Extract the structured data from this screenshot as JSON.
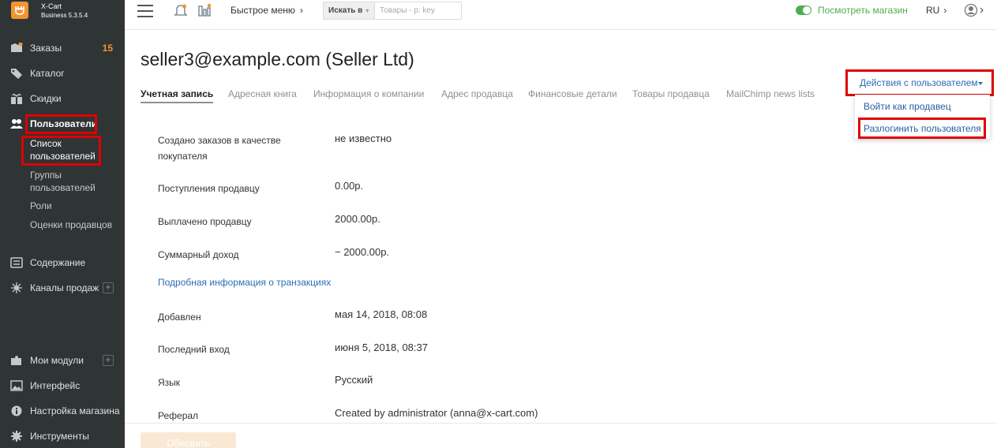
{
  "brand": {
    "name": "X-Cart",
    "version": "Business 5.3.5.4"
  },
  "sidebar": {
    "items": [
      {
        "label": "Заказы",
        "count": "15"
      },
      {
        "label": "Каталог"
      },
      {
        "label": "Скидки"
      },
      {
        "label": "Пользователи"
      }
    ],
    "users_sub": [
      "Список пользователей",
      "Группы пользователей",
      "Роли",
      "Оценки продавцов"
    ],
    "items2": [
      {
        "label": "Содержание"
      },
      {
        "label": "Каналы продаж"
      }
    ],
    "items3": [
      {
        "label": "Мои модули"
      },
      {
        "label": "Интерфейс"
      },
      {
        "label": "Настройка магазина"
      },
      {
        "label": "Инструменты"
      }
    ]
  },
  "header": {
    "quick_menu": "Быстрое меню",
    "search_in": "Искать в",
    "search_placeholder": "Товары - р: key",
    "view_store": "Посмотреть магазин",
    "lang": "RU"
  },
  "main": {
    "title": "seller3@example.com (Seller Ltd)",
    "tabs": [
      "Учетная запись",
      "Адресная книга",
      "Информация о компании",
      "Адрес продавца",
      "Финансовые детали",
      "Товары продавца",
      "MailChimp news lists"
    ],
    "fields": [
      {
        "label": "Создано заказов в качестве покупателя",
        "value": "не известно"
      },
      {
        "label": "Поступления продавцу",
        "value": "0.00р."
      },
      {
        "label": "Выплачено продавцу",
        "value": "2000.00р."
      },
      {
        "label": "Суммарный доход",
        "value": "− 2000.00р."
      }
    ],
    "detail_link": "Подробная информация о транзакциях",
    "fields2": [
      {
        "label": "Добавлен",
        "value": "мая 14, 2018, 08:08"
      },
      {
        "label": "Последний вход",
        "value": "июня 5, 2018, 08:37"
      },
      {
        "label": "Язык",
        "value": "Русский"
      },
      {
        "label": "Реферал",
        "value": "Created by administrator (anna@x-cart.com)"
      }
    ],
    "update_button": "Обновить"
  },
  "actions": {
    "button": "Действия с пользователем",
    "items": [
      "Войти как продавец",
      "Разлогинить пользователя"
    ]
  },
  "colors": {
    "accent": "#f29432",
    "sidebar_bg": "#2f3435",
    "link": "#2a6db5",
    "highlight": "#e00000",
    "success": "#4cae4c"
  }
}
